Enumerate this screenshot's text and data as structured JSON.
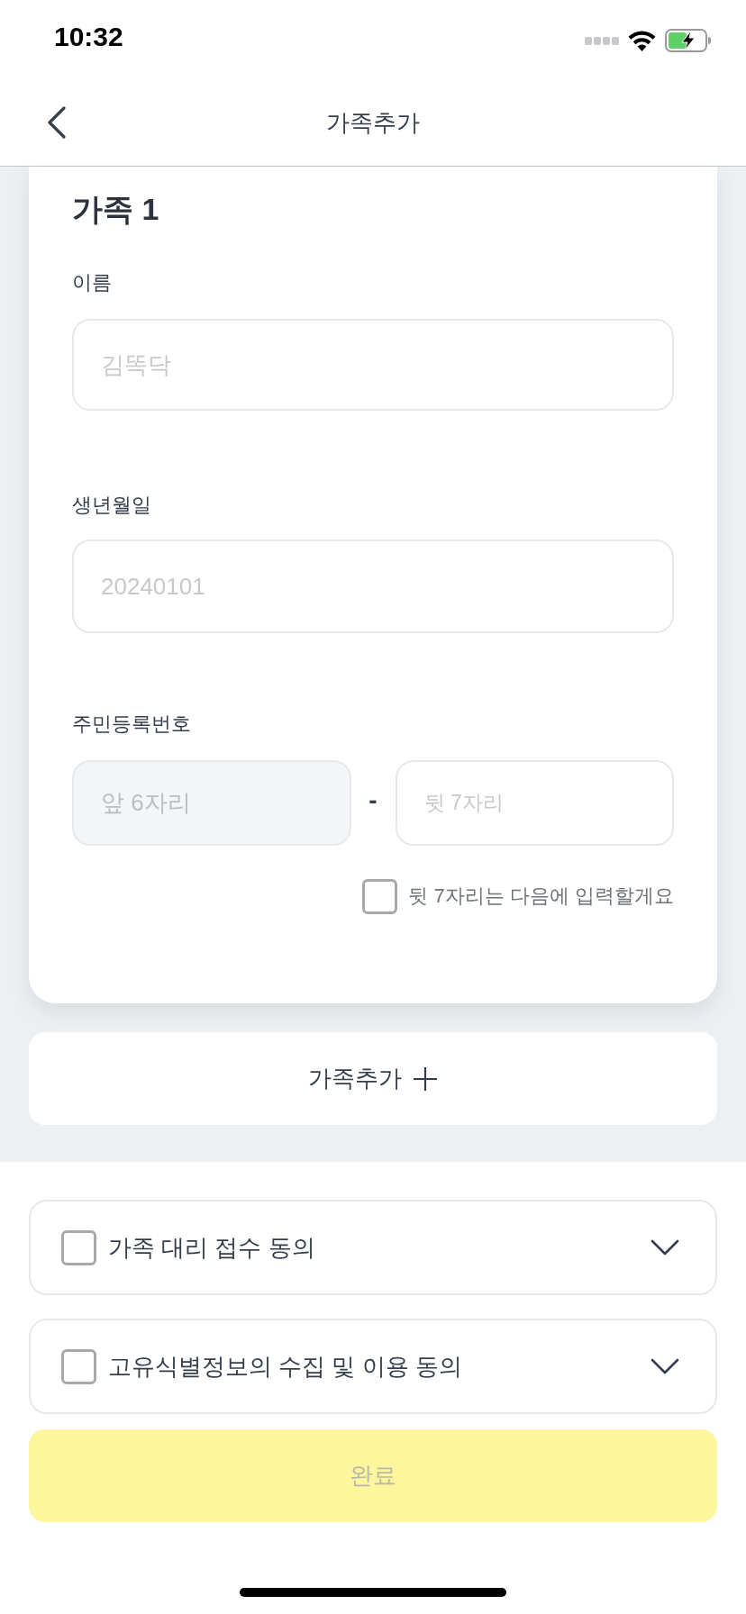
{
  "status_bar": {
    "time": "10:32"
  },
  "header": {
    "title": "가족추가"
  },
  "family_card": {
    "title": "가족 1",
    "name_field": {
      "label": "이름",
      "placeholder": "김똑닥"
    },
    "birth_field": {
      "label": "생년월일",
      "placeholder": "20240101"
    },
    "rrn_field": {
      "label": "주민등록번호",
      "front": {
        "placeholder": "앞 6자리",
        "disabled": true
      },
      "separator": "-",
      "back": {
        "placeholder": "뒷 7자리",
        "disabled": false
      }
    },
    "enter_later": {
      "label": "뒷 7자리는 다음에 입력할게요",
      "checked": false
    }
  },
  "add_family_button": {
    "label": "가족추가"
  },
  "agreements": [
    {
      "label": "가족 대리 접수 동의",
      "checked": false,
      "expanded": false
    },
    {
      "label": "고유식별정보의 수집 및 이용 동의",
      "checked": false,
      "expanded": false
    }
  ],
  "submit_button": {
    "label": "완료",
    "disabled": true
  }
}
